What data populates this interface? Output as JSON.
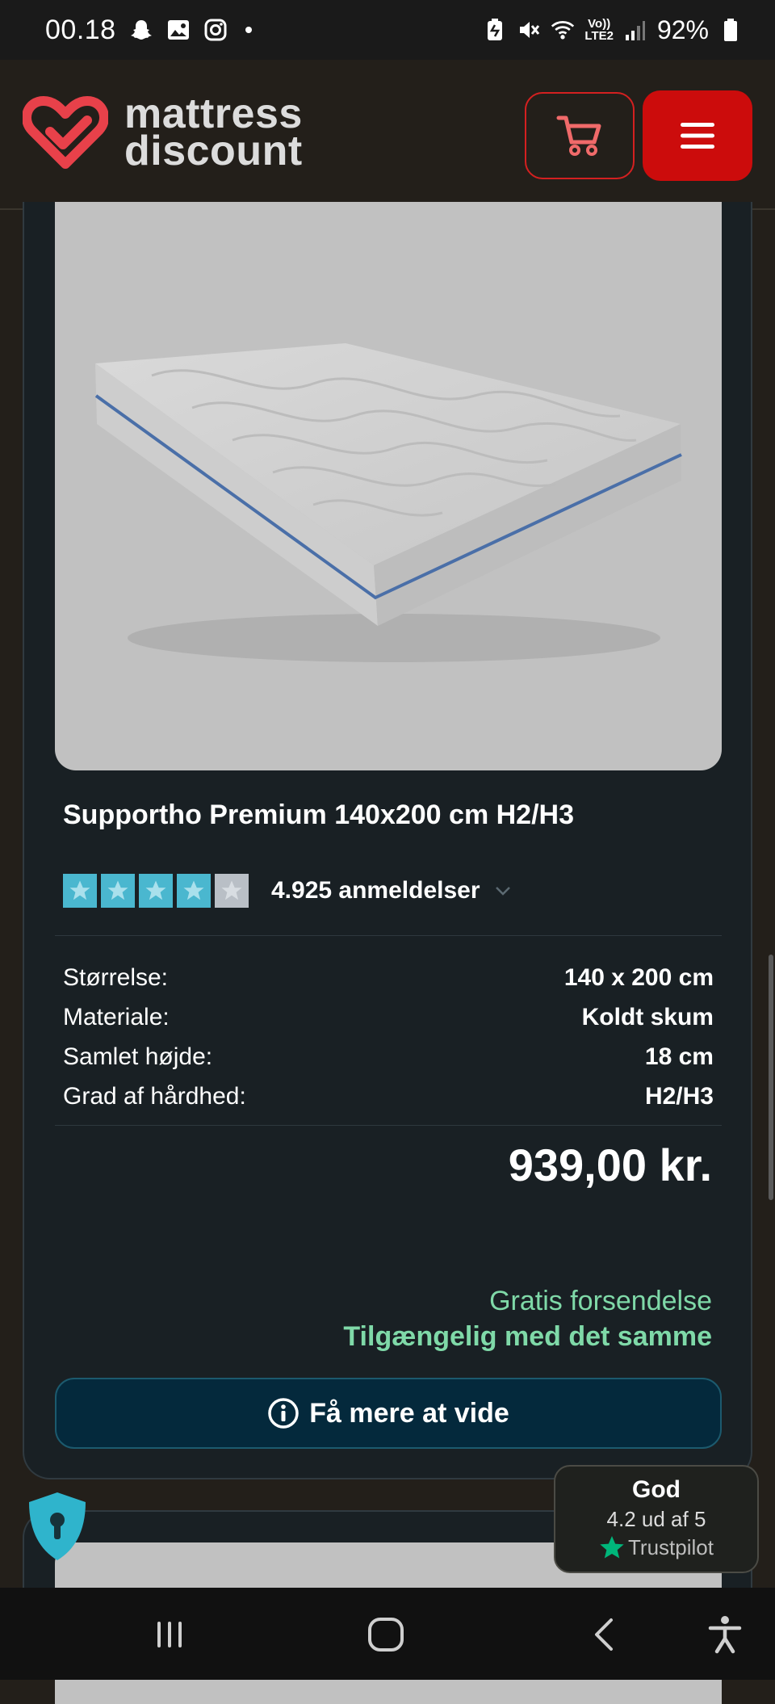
{
  "status_bar": {
    "time": "00.18",
    "battery_percent": "92%",
    "network_label": "LTE2",
    "volte_label": "Vo))"
  },
  "header": {
    "logo_line1": "mattress",
    "logo_line2": "discount",
    "brand_color": "#cc0c0c",
    "logo_heart_color": "#e8414a"
  },
  "product": {
    "title": "Supportho Premium 140x200 cm H2/H3",
    "rating_stars": 4,
    "rating_max": 5,
    "review_count_label": "4.925 anmeldelser",
    "specs": [
      {
        "label": "Størrelse:",
        "value": "140 x 200 cm"
      },
      {
        "label": "Materiale:",
        "value": "Koldt skum"
      },
      {
        "label": "Samlet højde:",
        "value": "18 cm"
      },
      {
        "label": "Grad af hårdhed:",
        "value": "H2/H3"
      }
    ],
    "price": "939,00 kr.",
    "shipping": "Gratis forsendelse",
    "availability": "Tilgængelig med det samme",
    "learn_more_label": "Få mere at vide",
    "accent_green": "#7fd9a8"
  },
  "trustpilot": {
    "rating_word": "God",
    "score": "4.2 ud af 5",
    "brand": "Trustpilot",
    "star_color": "#00b67a"
  },
  "icons": {
    "cart": "cart-icon",
    "menu": "hamburger-menu-icon",
    "privacy": "shield-keyhole-icon",
    "nav_recent": "recent-apps-icon",
    "nav_home": "home-icon",
    "nav_back": "back-icon",
    "nav_accessibility": "accessibility-icon"
  }
}
